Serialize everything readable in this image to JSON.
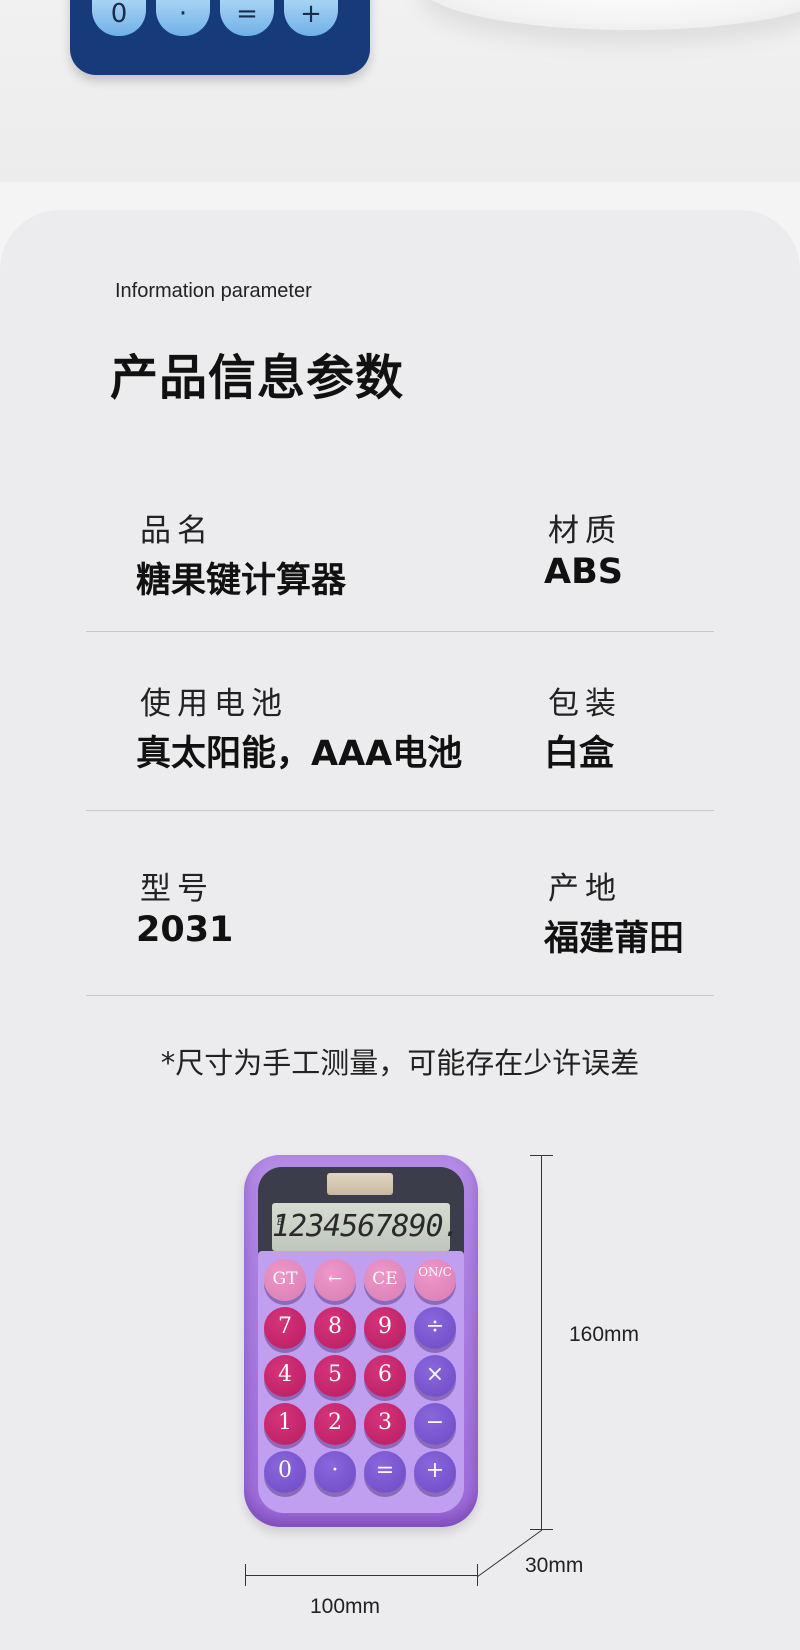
{
  "top_keys": [
    "0",
    "·",
    "=",
    "+"
  ],
  "section": {
    "subtitle": "Information parameter",
    "title": "产品信息参数"
  },
  "specs": [
    {
      "label": "品名",
      "value": "糖果键计算器"
    },
    {
      "label": "材质",
      "value": "ABS"
    },
    {
      "label": "使用电池",
      "value": "真太阳能，AAA电池"
    },
    {
      "label": "包装",
      "value": "白盒"
    },
    {
      "label": "型号",
      "value": "2031"
    },
    {
      "label": "产地",
      "value": "福建莆田"
    }
  ],
  "note": "*尺寸为手工测量，可能存在少许误差",
  "calculator": {
    "display": "1234567890.",
    "display_indicator": "E",
    "keys": [
      "GT",
      "←",
      "CE",
      "ON/C",
      "7",
      "8",
      "9",
      "÷",
      "4",
      "5",
      "6",
      "×",
      "1",
      "2",
      "3",
      "−",
      "0",
      "·",
      "=",
      "+"
    ]
  },
  "dimensions": {
    "height": "160mm",
    "width": "100mm",
    "depth": "30mm"
  }
}
